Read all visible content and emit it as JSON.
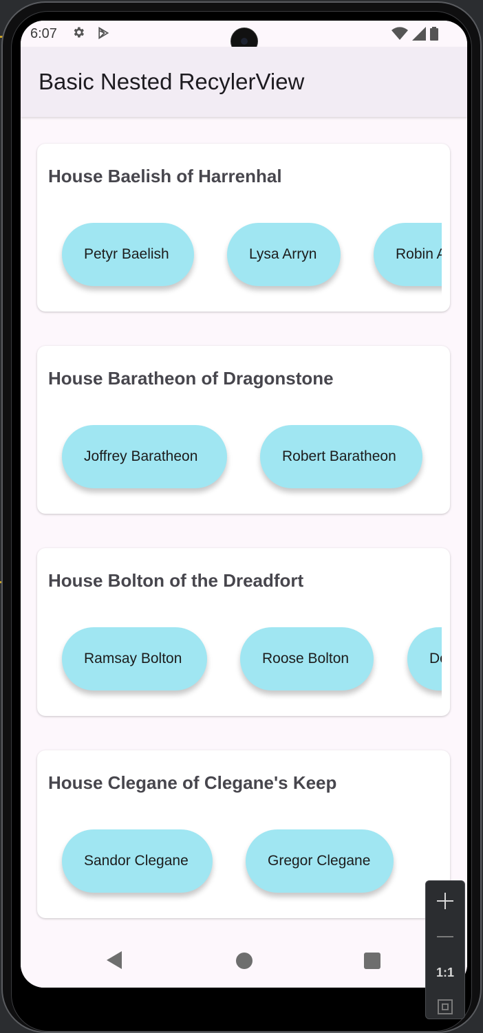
{
  "status_bar": {
    "time": "6:07",
    "left_icons": [
      "gear-icon",
      "play-store-icon"
    ],
    "right_icons": [
      "wifi-icon",
      "signal-icon",
      "battery-icon"
    ]
  },
  "app_bar": {
    "title": "Basic Nested RecylerView"
  },
  "houses": [
    {
      "title": "House Baelish of Harrenhal",
      "members": [
        "Petyr Baelish",
        "Lysa Arryn",
        "Robin Arryn"
      ]
    },
    {
      "title": "House Baratheon of Dragonstone",
      "members": [
        "Joffrey Baratheon",
        "Robert Baratheon"
      ]
    },
    {
      "title": "House Bolton of the Dreadfort",
      "members": [
        "Ramsay Bolton",
        "Roose Bolton",
        "Domeric Bolton"
      ]
    },
    {
      "title": "House Clegane of Clegane's Keep",
      "members": [
        "Sandor Clegane",
        "Gregor Clegane"
      ]
    }
  ],
  "nav_bar": {
    "icons": [
      "back-icon",
      "home-icon",
      "recents-icon"
    ]
  },
  "zoom_controls": {
    "reset_label": "1:1"
  },
  "colors": {
    "chip": "#a0e6f2",
    "app_bar": "#f2ecf4",
    "screen_bg": "#fdf7fc",
    "card_title": "#47464d"
  }
}
